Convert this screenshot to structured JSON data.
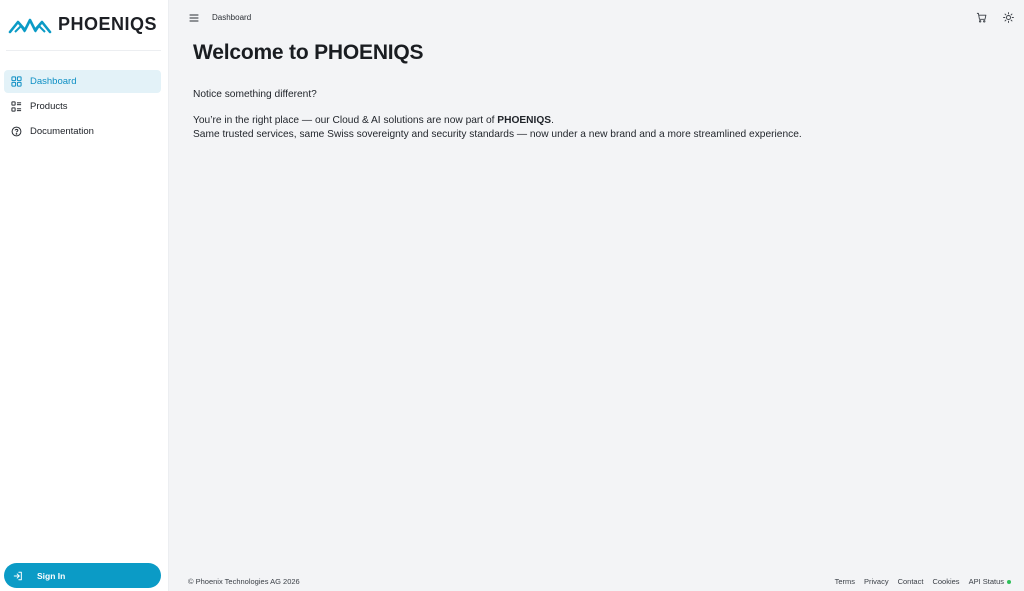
{
  "brand": {
    "name": "PHOENIQS",
    "logo_icon": "phoeniqs-logo",
    "accent": "#0b9bc6"
  },
  "sidebar": {
    "items": [
      {
        "label": "Dashboard",
        "icon": "grid-icon",
        "active": true
      },
      {
        "label": "Products",
        "icon": "list-icon",
        "active": false
      },
      {
        "label": "Documentation",
        "icon": "help-circle-icon",
        "active": false
      }
    ],
    "signin_label": "Sign In"
  },
  "header": {
    "breadcrumb": "Dashboard",
    "actions": [
      "cart-icon",
      "theme-toggle-icon"
    ]
  },
  "main": {
    "title": "Welcome to PHOENIQS",
    "notice": "Notice something different?",
    "line1_prefix": "You’re in the right place — our Cloud & AI solutions are now part of ",
    "line1_brand": "PHOENIQS",
    "line1_suffix": ".",
    "line2": "Same trusted services, same Swiss sovereignty and security standards — now under a new brand and a more streamlined experience."
  },
  "footer": {
    "copyright": "© Phoenix Technologies AG 2026",
    "links": [
      "Terms",
      "Privacy",
      "Contact",
      "Cookies",
      "API Status"
    ],
    "status_color": "#2fbf5a"
  }
}
